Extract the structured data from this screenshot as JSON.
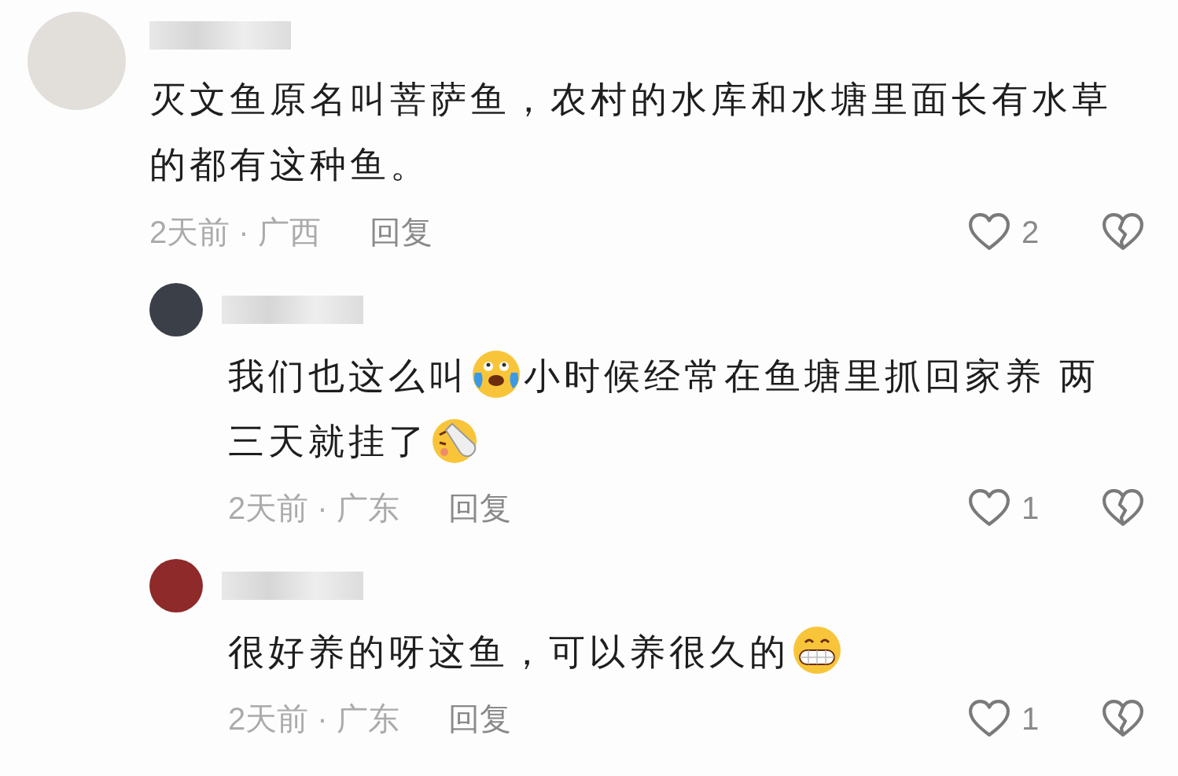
{
  "comments": [
    {
      "text": [
        {
          "kind": "text",
          "text": "灭文鱼原名叫菩萨鱼，农村的水库和水塘里面长有水草的都有这种鱼。"
        }
      ],
      "meta": "2天前 · 广西",
      "reply_label": "回复",
      "likes": "2",
      "replies": [
        {
          "text": [
            {
              "kind": "text",
              "text": "我们也这么叫 "
            },
            {
              "kind": "tears-emoji"
            },
            {
              "kind": "text",
              "text": "小时候经常在鱼塘里抓回家养 两"
            },
            {
              "kind": "text",
              "text": "三天就挂了"
            },
            {
              "kind": "bottle-emoji"
            }
          ],
          "meta": "2天前 · 广东",
          "reply_label": "回复",
          "likes": "1"
        },
        {
          "text": [
            {
              "kind": "text",
              "text": "很好养的呀这鱼，可以养很久的"
            },
            {
              "kind": "grin-emoji"
            }
          ],
          "meta": "2天前 · 广东",
          "reply_label": "回复",
          "likes": "1"
        }
      ]
    }
  ]
}
